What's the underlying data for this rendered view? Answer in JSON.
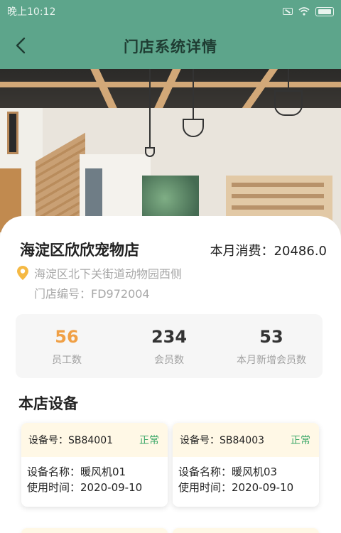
{
  "status_bar": {
    "time": "晚上10:12"
  },
  "header": {
    "title": "门店系统详情"
  },
  "store": {
    "name": "海淀区欣欣宠物店",
    "monthly_spend": "本月消费：20486.0",
    "address": "海淀区北下关街道动物园西侧",
    "code": "门店编号：FD972004"
  },
  "stats": [
    {
      "value": "56",
      "label": "员工数"
    },
    {
      "value": "234",
      "label": "会员数"
    },
    {
      "value": "53",
      "label": "本月新增会员数"
    }
  ],
  "devices_section": {
    "title": "本店设备"
  },
  "devices": [
    {
      "id": "设备号：SB84001",
      "status": "正常",
      "name": "设备名称：暖风机01",
      "time": "使用时间：2020-09-10"
    },
    {
      "id": "设备号：SB84003",
      "status": "正常",
      "name": "设备名称：暖风机03",
      "time": "使用时间：2020-09-10"
    }
  ],
  "colors": {
    "header_bg": "#5da58b",
    "accent": "#f0a046",
    "status_ok": "#3fa96a",
    "pin": "#f5b944"
  },
  "icons": {
    "back": "chevron-left-icon",
    "location": "location-pin-icon",
    "wifi": "wifi-icon",
    "battery": "battery-icon"
  }
}
